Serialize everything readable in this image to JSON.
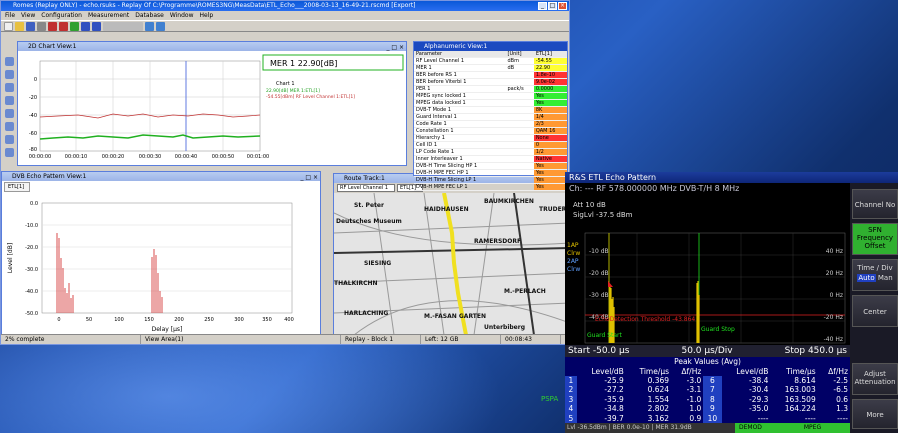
{
  "app": {
    "title": "Romes (Replay ONLY) - echo.rsuks - Replay Of C:\\Programme\\ROMES3NG\\MeasData\\ETL_Echo___2008-03-13_16-49-21.rscmd [Export]",
    "menu": [
      "File",
      "View",
      "Configuration",
      "Measurement",
      "Database",
      "Window",
      "Help"
    ],
    "win_ctrls": [
      "_",
      "□",
      "×"
    ]
  },
  "chart2d": {
    "title": "2D Chart View:1",
    "legend_title": "MER 1   22.90[dB]",
    "legend_chart": "Chart 1",
    "legend_l1": "22.90[dB]   MER 1:ETL[1]",
    "legend_l2": "-54.55[dBm]  RF Level Channel 1:ETL[1]",
    "yticks": [
      "0",
      "-20",
      "-40",
      "-60",
      "-80"
    ],
    "xticks": [
      "00:00:00",
      "00:00:10",
      "00:00:20",
      "00:00:30",
      "00:00:40",
      "00:00:50",
      "00:01:00"
    ]
  },
  "alpha": {
    "title": "Alphanumeric View:1",
    "headers": [
      "Parameter",
      "[Unit]",
      "ETL[1]"
    ],
    "rows": [
      {
        "p": "RF Level Channel 1",
        "u": "dBm",
        "v": "-54.55",
        "c": "#ffff33"
      },
      {
        "p": "MER 1",
        "u": "dB",
        "v": "22.90",
        "c": "#ffff33"
      },
      {
        "p": "BER before RS 1",
        "u": "",
        "v": "1.8e-10",
        "c": "#ff3333"
      },
      {
        "p": "BER before Viterbi 1",
        "u": "",
        "v": "9.0e-02",
        "c": "#ff3333"
      },
      {
        "p": "PER 1",
        "u": "pack/s",
        "v": "0.0000",
        "c": "#33ee33"
      },
      {
        "p": "MPEG sync locked 1",
        "u": "",
        "v": "Yes",
        "c": "#33ee33"
      },
      {
        "p": "MPEG data locked 1",
        "u": "",
        "v": "Yes",
        "c": "#33ee33"
      },
      {
        "p": "DVB-T Mode 1",
        "u": "",
        "v": "8K",
        "c": "#ff9933"
      },
      {
        "p": "Guard Interval 1",
        "u": "",
        "v": "1/4",
        "c": "#ff9933"
      },
      {
        "p": "Code Rate 1",
        "u": "",
        "v": "2/3",
        "c": "#ff9933"
      },
      {
        "p": "Constellation 1",
        "u": "",
        "v": "QAM 16",
        "c": "#ff9933"
      },
      {
        "p": "Hierarchy 1",
        "u": "",
        "v": "None",
        "c": "#ff3333"
      },
      {
        "p": "Cell ID 1",
        "u": "",
        "v": "0",
        "c": "#ff9933"
      },
      {
        "p": "LP Code Rate 1",
        "u": "",
        "v": "1/2",
        "c": "#ff9933"
      },
      {
        "p": "Inner Interleaver 1",
        "u": "",
        "v": "Native",
        "c": "#ff3333"
      },
      {
        "p": "DVB-H Time Slicing HP 1",
        "u": "",
        "v": "Yes",
        "c": "#ff9933"
      },
      {
        "p": "DVB-H MPE FEC HP 1",
        "u": "",
        "v": "Yes",
        "c": "#ff9933"
      },
      {
        "p": "DVB-H Time Slicing LP 1",
        "u": "",
        "v": "Yes",
        "c": "#ff9933"
      },
      {
        "p": "DVB-H MPE FEC LP 1",
        "u": "",
        "v": "Yes",
        "c": "#ff9933"
      }
    ]
  },
  "echo": {
    "title": "DVB Echo Pattern View:1",
    "tab": "ETL[1]",
    "ylabel": "Level [dB]",
    "xlabel": "Delay [µs]",
    "yticks": [
      "0.0",
      "-10.0",
      "-20.0",
      "-30.0",
      "-40.0",
      "-50.0"
    ],
    "xticks": [
      "0",
      "50",
      "100",
      "150",
      "200",
      "250",
      "300",
      "350",
      "400"
    ]
  },
  "route": {
    "title": "Route Track:1",
    "sel1": "RF Level Channel 1",
    "sel2": "ETL[1]",
    "labels": [
      "St. Peter",
      "Deutsches Museum",
      "HAIDHAUSEN",
      "BAUMKIRCHEN",
      "TRUDER",
      "RAMERSDORF",
      "SIESING",
      "THALKIRCHN",
      "M.-PERLACH",
      "HARLACHING",
      "M.-FASAN GARTEN",
      "Unterbiberg"
    ]
  },
  "status": {
    "left": "2% complete",
    "tab": "View Area(1)",
    "block": "Replay - Block 1",
    "left_gb": "Left: 12 GB",
    "time": "00:08:43"
  },
  "rs": {
    "title": "R&S ETL Echo Pattern",
    "info": "Ch: ---  RF 578.000000 MHz  DVB-T/H  8 MHz",
    "att": "Att  10 dB",
    "siglvl": "SigLvl -37.5 dBm",
    "trace": [
      "1AP",
      "Clrw",
      "2AP",
      "Clrw"
    ],
    "left_ticks": [
      "-10 dB",
      "-20 dB",
      "-30 dB",
      "-40 dB"
    ],
    "right_ticks": [
      "40 Hz",
      "20 Hz",
      "0 Hz",
      "-20 Hz",
      "-40 Hz"
    ],
    "threshold": "EchoDetection Threshold -43.864",
    "guard_start": "Guard Start",
    "guard_stop": "Guard Stop",
    "start": "Start -50.0 µs",
    "div": "50.0 µs/Div",
    "stop": "Stop 450.0 µs",
    "peak_title": "Peak Values (Avg)",
    "peak_headers": [
      "",
      "Level/dB",
      "Time/µs",
      "Δf/Hz",
      "",
      "Level/dB",
      "Time/µs",
      "Δf/Hz"
    ],
    "peak_rows": [
      [
        "1",
        "-25.9",
        "0.369",
        "-3.0",
        "6",
        "-38.4",
        "8.614",
        "-2.5"
      ],
      [
        "2",
        "-27.2",
        "0.624",
        "-3.1",
        "7",
        "-30.4",
        "163.003",
        "-6.5"
      ],
      [
        "3",
        "-35.9",
        "1.554",
        "-1.0",
        "8",
        "-29.3",
        "163.509",
        "0.6"
      ],
      [
        "4",
        "-34.8",
        "2.802",
        "1.0",
        "9",
        "-35.0",
        "164.224",
        "1.3"
      ],
      [
        "5",
        "-39.7",
        "3.162",
        "0.9",
        "10",
        "----",
        "----",
        "----"
      ]
    ],
    "pspa": "PSPA",
    "bottom_l": "Lvl -36.5dBm | BER 0.0e-10 | MER 31.9dB",
    "bottom_d": "DEMOD",
    "bottom_m": "MPEG",
    "softkeys": [
      "Channel No",
      "SFN Frequency Offset",
      "Time / Div",
      "Center",
      "Adjust Attenuation",
      "More"
    ],
    "auto": "Auto",
    "man": "Man"
  }
}
